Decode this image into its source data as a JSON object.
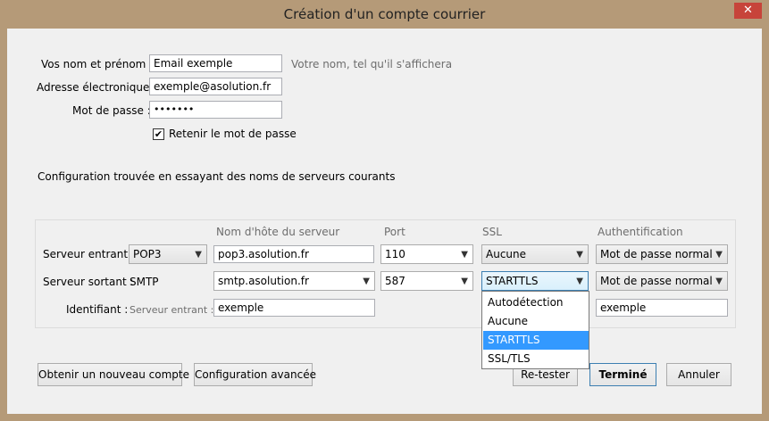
{
  "window": {
    "title": "Création d'un compte courrier",
    "close_glyph": "✕"
  },
  "identity": {
    "name_label": "Vos nom et prénom :",
    "name_value": "Email exemple",
    "name_hint": "Votre nom, tel qu'il s'affichera",
    "email_label": "Adresse électronique :",
    "email_value": "exemple@asolution.fr",
    "password_label": "Mot de passe :",
    "password_value": "•••••••",
    "remember_label": "Retenir le mot de passe",
    "remember_checked": true,
    "remember_glyph": "✔"
  },
  "status_message": "Configuration trouvée en essayant des noms de serveurs courants",
  "server_table": {
    "headers": {
      "hostname": "Nom d'hôte du serveur",
      "port": "Port",
      "ssl": "SSL",
      "auth": "Authentification"
    },
    "incoming": {
      "label": "Serveur entrant :",
      "protocol": "POP3",
      "hostname": "pop3.asolution.fr",
      "port": "110",
      "ssl": "Aucune",
      "auth": "Mot de passe normal"
    },
    "outgoing": {
      "label": "Serveur sortant :",
      "protocol": "SMTP",
      "hostname": "smtp.asolution.fr",
      "port": "587",
      "ssl": "STARTTLS",
      "auth": "Mot de passe normal"
    },
    "identifier": {
      "label": "Identifiant :",
      "sublabel": "Serveur entrant :",
      "incoming_value": "exemple",
      "outgoing_value": "exemple"
    }
  },
  "ssl_dropdown": {
    "options": [
      "Autodétection",
      "Aucune",
      "STARTTLS",
      "SSL/TLS"
    ],
    "selected": "STARTTLS"
  },
  "buttons": {
    "new_account": "Obtenir un nouveau compte",
    "advanced": "Configuration avancée",
    "retest": "Re-tester",
    "done": "Terminé",
    "cancel": "Annuler"
  }
}
